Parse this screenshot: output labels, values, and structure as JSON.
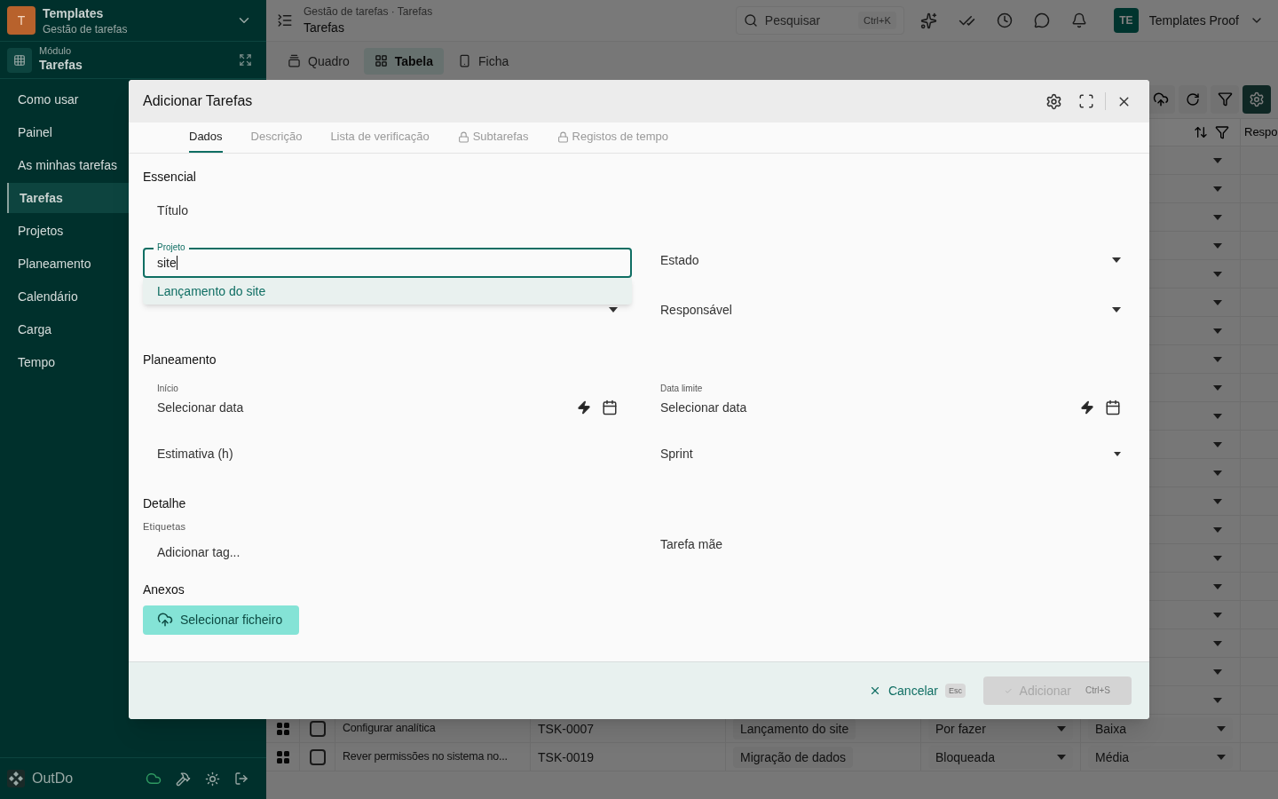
{
  "sidebar": {
    "workspace": {
      "initial": "T",
      "name": "Templates",
      "subtitle": "Gestão de tarefas"
    },
    "module": {
      "label": "Módulo",
      "name": "Tarefas"
    },
    "items": [
      {
        "label": "Como usar",
        "selected": false
      },
      {
        "label": "Painel",
        "selected": false
      },
      {
        "label": "As minhas tarefas",
        "selected": false
      },
      {
        "label": "Tarefas",
        "selected": true
      },
      {
        "label": "Projetos",
        "selected": false
      },
      {
        "label": "Planeamento",
        "selected": false
      },
      {
        "label": "Calendário",
        "selected": false
      },
      {
        "label": "Carga",
        "selected": false
      },
      {
        "label": "Tempo",
        "selected": false
      }
    ],
    "brand": "OutDo"
  },
  "topbar": {
    "breadcrumb": "Gestão de tarefas · Tarefas",
    "title": "Tarefas",
    "search": {
      "placeholder": "Pesquisar",
      "shortcut": "Ctrl+K"
    },
    "user": {
      "initials": "TE",
      "name": "Templates Proof"
    }
  },
  "views": [
    {
      "label": "Quadro",
      "kind": "board",
      "selected": false
    },
    {
      "label": "Tabela",
      "kind": "table",
      "selected": true
    },
    {
      "label": "Ficha",
      "kind": "form",
      "selected": false
    }
  ],
  "table": {
    "columns": [
      {
        "label": "Respo"
      }
    ],
    "rows": [
      {
        "title": "Configurar analítica",
        "checked": false,
        "id": "TSK-0007",
        "project": "Lançamento do site",
        "status": "Por fazer",
        "priority": "Baixa"
      },
      {
        "title": "Rever permissões no sistema no...",
        "checked": false,
        "id": "TSK-0019",
        "project": "Migração de dados",
        "status": "Bloqueada",
        "priority": "Média"
      }
    ]
  },
  "dialog": {
    "title": "Adicionar Tarefas",
    "tabs": [
      {
        "label": "Dados",
        "selected": true,
        "locked": false
      },
      {
        "label": "Descrição",
        "selected": false,
        "locked": false
      },
      {
        "label": "Lista de verificação",
        "selected": false,
        "locked": false
      },
      {
        "label": "Subtarefas",
        "selected": false,
        "locked": true
      },
      {
        "label": "Registos de tempo",
        "selected": false,
        "locked": true
      }
    ],
    "sections": [
      {
        "title": "Essencial",
        "rows": [
          [
            {
              "kind": "text",
              "placeholder": "Título"
            }
          ],
          [
            {
              "kind": "autocomplete",
              "label": "Projeto",
              "value": "site",
              "suggestions": [
                "Lançamento do site"
              ]
            },
            {
              "kind": "select",
              "placeholder": "Estado"
            }
          ],
          [
            {
              "kind": "select"
            },
            {
              "kind": "select",
              "placeholder": "Responsável"
            }
          ]
        ]
      },
      {
        "title": "Planeamento",
        "rows": [
          [
            {
              "kind": "date",
              "label": "Início",
              "placeholder": "Selecionar data"
            },
            {
              "kind": "date",
              "label": "Data limite",
              "placeholder": "Selecionar data"
            }
          ],
          [
            {
              "kind": "text",
              "placeholder": "Estimativa (h)"
            },
            {
              "kind": "small-select",
              "placeholder": "Sprint"
            }
          ]
        ]
      },
      {
        "title": "Detalhe",
        "rows": [
          [
            {
              "kind": "tags",
              "label": "Etiquetas",
              "placeholder": "Adicionar tag..."
            },
            {
              "kind": "text",
              "placeholder": "Tarefa mãe"
            }
          ]
        ]
      },
      {
        "title": "Anexos",
        "rows": [
          [
            {
              "kind": "upload",
              "label": "Selecionar ficheiro"
            }
          ]
        ]
      }
    ],
    "cancel": {
      "label": "Cancelar",
      "shortcut": "Esc"
    },
    "submit": {
      "label": "Adicionar",
      "shortcut": "Ctrl+S",
      "disabled": true
    }
  }
}
